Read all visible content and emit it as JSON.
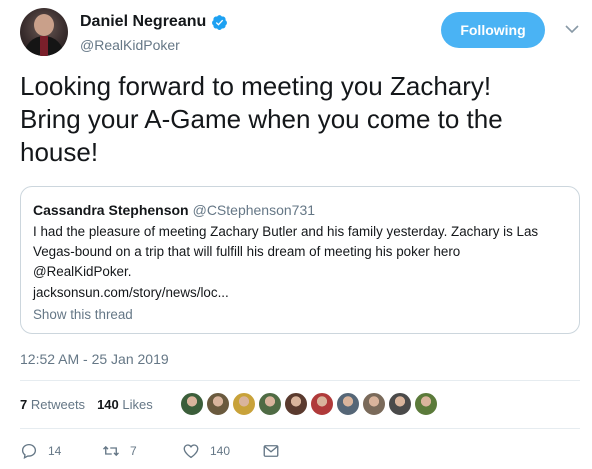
{
  "author": {
    "display_name": "Daniel Negreanu",
    "handle": "@RealKidPoker",
    "verified": true
  },
  "follow_button_label": "Following",
  "tweet": {
    "line1": "Looking forward to meeting you Zachary!",
    "line2": "Bring your A-Game when you come to the",
    "line3": "house!"
  },
  "quoted_tweet": {
    "display_name": "Cassandra Stephenson",
    "handle": "@CStephenson731",
    "body_line1": "I had the pleasure of meeting Zachary Butler and his family yesterday. Zachary is Las",
    "body_line2": "Vegas-bound on a trip that will fulfill his dream of meeting his poker hero",
    "body_line3": "@RealKidPoker.",
    "link": "jacksonsun.com/story/news/loc...",
    "show_thread_label": "Show this thread"
  },
  "timestamp": "12:52 AM - 25 Jan 2019",
  "stats": {
    "retweets_count": "7",
    "retweets_label": "Retweets",
    "likes_count": "140",
    "likes_label": "Likes"
  },
  "liker_avatar_colors": [
    "#3b5e3a",
    "#6a5a3e",
    "#c8a23a",
    "#4f6b44",
    "#5a3a2e",
    "#b03a3a",
    "#556677",
    "#7a6a5a",
    "#4a4a4a",
    "#5b7a3a"
  ],
  "actions": {
    "reply_count": "14",
    "retweet_count": "7",
    "like_count": "140"
  },
  "colors": {
    "accent": "#4ab3f4",
    "secondary_text": "#657786",
    "border": "#ccd6dd"
  }
}
